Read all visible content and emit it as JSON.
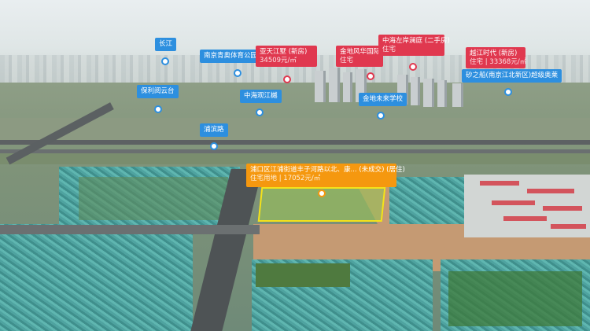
{
  "labels": {
    "changjiang": "长江",
    "nanjing_youth": "南京青奥体育公园体育馆",
    "tianjiang": {
      "title": "亚天江墅",
      "tag": "(新房)",
      "line2": "34509元/㎡"
    },
    "jindi_fenghua": {
      "title": "金地风华国际",
      "line2": "住宅"
    },
    "zhonghai_zuoan": {
      "title": "中海左岸澜庭",
      "tag": "(二手房)",
      "line2": "住宅"
    },
    "yuejiang": {
      "title": "越江时代",
      "tag": "(新房)",
      "line2": "住宅",
      "price": "33368元/㎡"
    },
    "binjiang_guanyun": "保利阅云台",
    "zhonghai_guanjiang": "中海观江樾",
    "jindi_future": "金地未来学校",
    "puzhou_road": "浦滨路",
    "ship_land": "砂之船(南京江北新区)超级奥莱",
    "parcel": {
      "title": "浦口区江浦街道丰子河路以北、康...",
      "tag1": "(未成交)",
      "tag2": "(居住)",
      "line2": "住宅用地",
      "price": "17052元/㎡"
    }
  },
  "colors": {
    "blue": "#2d8fdf",
    "red": "#e0384f",
    "orange": "#f5980f",
    "plot_border": "#f5e21a"
  }
}
